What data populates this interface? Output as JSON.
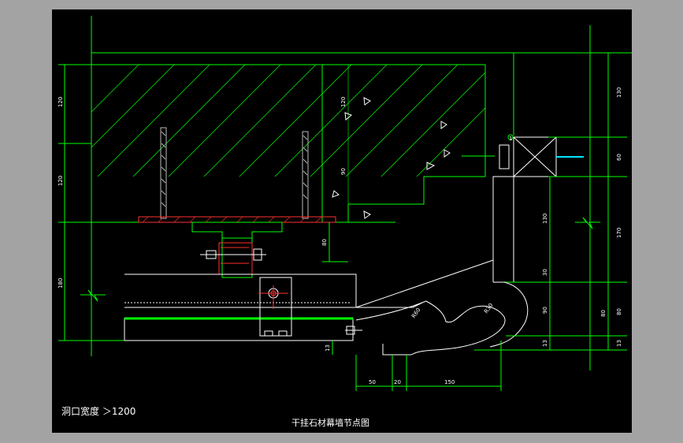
{
  "drawing": {
    "title": "干挂石材幕墙节点图",
    "opening_note": "洞口宽度 ＞1200",
    "colors": {
      "background": "#000000",
      "frame": "#a3a3a3",
      "line": "#00ff00",
      "dimension": "#ffffff",
      "steel": "#ff3030",
      "accent": "#00e5ff"
    },
    "left_dims": [
      "120",
      "120",
      "180"
    ],
    "right_dims": [
      "130",
      "60",
      "170",
      "80",
      "13"
    ],
    "inner_dims": [
      "130",
      "30",
      "90",
      "80",
      "13"
    ],
    "bottom_dims": [
      "50",
      "20",
      "150"
    ],
    "concrete_dims": [
      "120",
      "90"
    ],
    "misc_dims": [
      "80",
      "13"
    ],
    "radius_labels": [
      "R60",
      "R30"
    ],
    "hatch_labels": [
      "1"
    ]
  }
}
